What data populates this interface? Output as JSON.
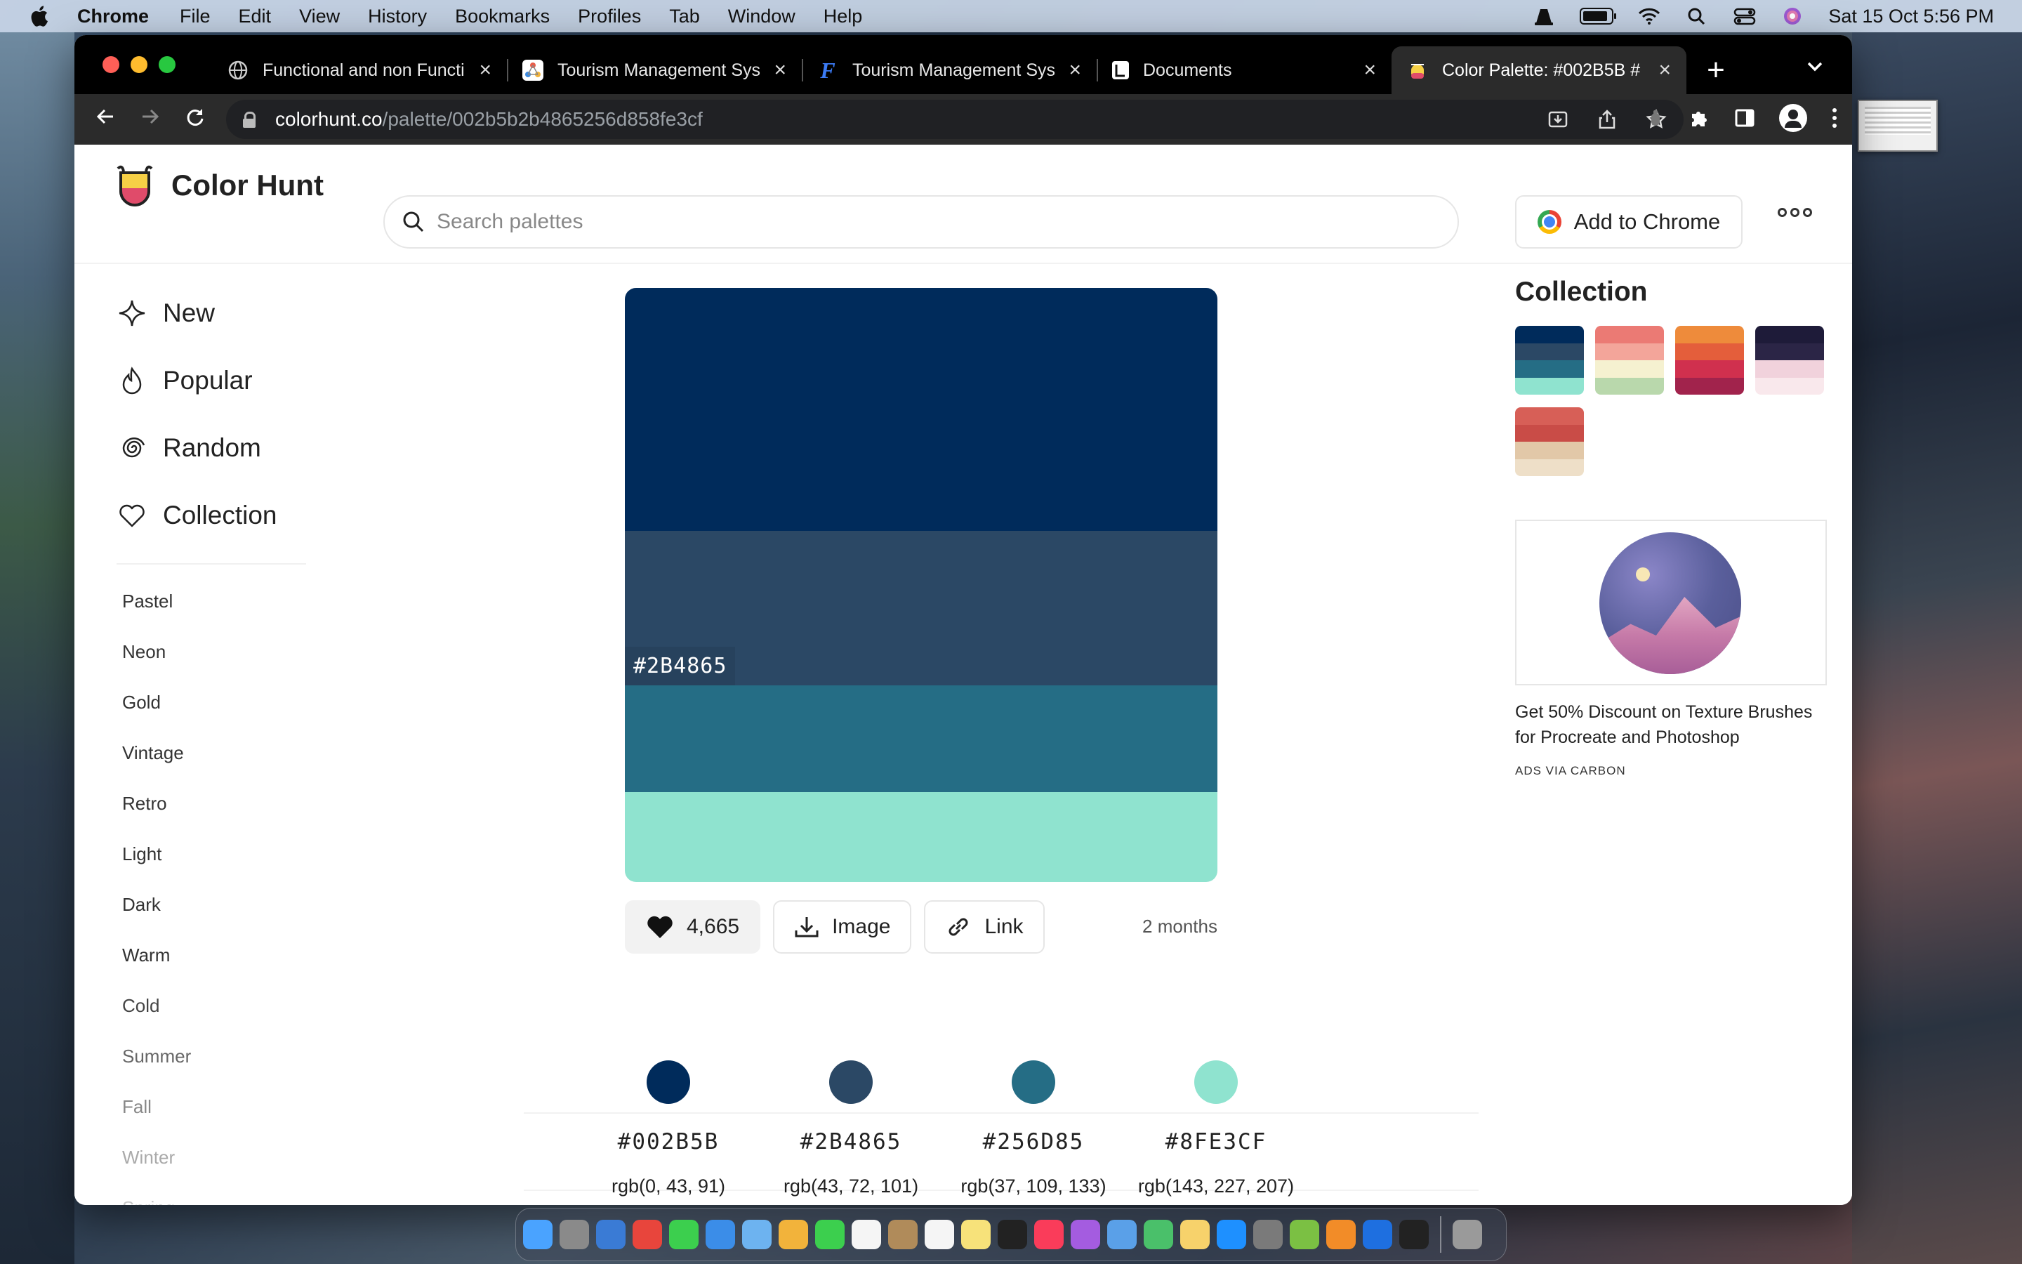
{
  "menubar": {
    "app": "Chrome",
    "items": [
      "File",
      "Edit",
      "View",
      "History",
      "Bookmarks",
      "Profiles",
      "Tab",
      "Window",
      "Help"
    ],
    "clock": "Sat 15 Oct  5:56 PM"
  },
  "tabs": [
    {
      "title": "Functional and non Functi",
      "favicon": "globe-icon",
      "active": false
    },
    {
      "title": "Tourism Management Sys",
      "favicon": "diagram-icon",
      "active": false
    },
    {
      "title": "Tourism Management Sys",
      "favicon": "f-icon",
      "active": false
    },
    {
      "title": "Documents",
      "favicon": "docs-icon",
      "active": false
    },
    {
      "title": "Color Palette: #002B5B #",
      "favicon": "colorhunt-icon",
      "active": true
    }
  ],
  "address": {
    "host": "colorhunt.co",
    "path": "/palette/002b5b2b4865256d858fe3cf"
  },
  "site": {
    "name": "Color Hunt",
    "search_placeholder": "Search palettes",
    "add_to_chrome": "Add to Chrome"
  },
  "sidebar": {
    "main": [
      {
        "label": "New",
        "icon": "sparkle-icon"
      },
      {
        "label": "Popular",
        "icon": "flame-icon"
      },
      {
        "label": "Random",
        "icon": "spiral-icon"
      },
      {
        "label": "Collection",
        "icon": "heart-outline-icon"
      }
    ],
    "tags": [
      {
        "label": "Pastel",
        "color": "#333333"
      },
      {
        "label": "Neon",
        "color": "#333333"
      },
      {
        "label": "Gold",
        "color": "#333333"
      },
      {
        "label": "Vintage",
        "color": "#333333"
      },
      {
        "label": "Retro",
        "color": "#333333"
      },
      {
        "label": "Light",
        "color": "#333333"
      },
      {
        "label": "Dark",
        "color": "#333333"
      },
      {
        "label": "Warm",
        "color": "#333333"
      },
      {
        "label": "Cold",
        "color": "#444444"
      },
      {
        "label": "Summer",
        "color": "#666666"
      },
      {
        "label": "Fall",
        "color": "#888888"
      },
      {
        "label": "Winter",
        "color": "#aaaaaa"
      },
      {
        "label": "Spring",
        "color": "#c6c6c6"
      }
    ]
  },
  "palette": {
    "colors": [
      "#002B5B",
      "#2B4865",
      "#256D85",
      "#8FE3CF"
    ],
    "hovered_label": "#2B4865",
    "likes": "4,665",
    "image_label": "Image",
    "link_label": "Link",
    "time_ago": "2 months",
    "details": [
      {
        "hex": "#002B5B",
        "rgb": "rgb(0, 43, 91)",
        "color": "#002B5B"
      },
      {
        "hex": "#2B4865",
        "rgb": "rgb(43, 72, 101)",
        "color": "#2B4865"
      },
      {
        "hex": "#256D85",
        "rgb": "rgb(37, 109, 133)",
        "color": "#256D85"
      },
      {
        "hex": "#8FE3CF",
        "rgb": "rgb(143, 227, 207)",
        "color": "#8FE3CF"
      }
    ]
  },
  "collection": {
    "title": "Collection",
    "palettes": [
      [
        "#002B5B",
        "#2B4865",
        "#256D85",
        "#8FE3CF"
      ],
      [
        "#EB7A74",
        "#F3A59A",
        "#F5F1D0",
        "#B9D8AC"
      ],
      [
        "#EE8B3B",
        "#E45E3B",
        "#D0304E",
        "#A1234C"
      ],
      [
        "#1E1B39",
        "#2B2546",
        "#F1D2DC",
        "#F9E8EC"
      ],
      [
        "#D75F57",
        "#C94C47",
        "#E2C8A8",
        "#EEDFC8"
      ]
    ]
  },
  "ad": {
    "text": "Get 50% Discount on Texture Brushes for Procreate and Photoshop",
    "via": "ADS VIA CARBON"
  },
  "dock_colors": [
    "#4aa3ff",
    "#8a8a8a",
    "#3a7bd5",
    "#e8453c",
    "#3ccf4e",
    "#3b8de8",
    "#6db3f0",
    "#f2b33b",
    "#3ccf4e",
    "#f5f5f5",
    "#b08b5a",
    "#f5f5f5",
    "#f7e27a",
    "#222222",
    "#fa3c5a",
    "#a45ce0",
    "#5aa0e8",
    "#4ac06a",
    "#f7d26b",
    "#1e90ff",
    "#7a7a7a",
    "#7bc043",
    "#f28c28",
    "#1e6fe0",
    "#222222",
    "#9a9a9a"
  ]
}
